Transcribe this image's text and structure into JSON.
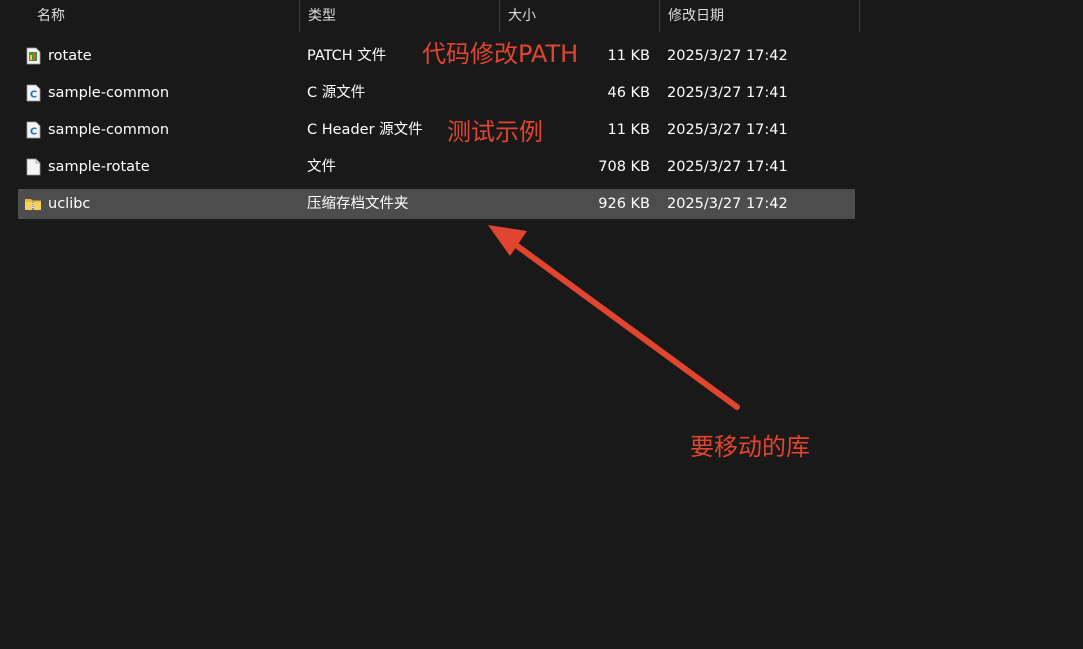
{
  "columns": {
    "name": "名称",
    "type": "类型",
    "size": "大小",
    "date": "修改日期"
  },
  "files": [
    {
      "name": "rotate",
      "type": "PATCH 文件",
      "size": "11 KB",
      "date": "2025/3/27 17:42",
      "icon": "patch-file-icon",
      "selected": false
    },
    {
      "name": "sample-common",
      "type": "C 源文件",
      "size": "46 KB",
      "date": "2025/3/27 17:41",
      "icon": "c-source-file-icon",
      "selected": false
    },
    {
      "name": "sample-common",
      "type": "C Header 源文件",
      "size": "11 KB",
      "date": "2025/3/27 17:41",
      "icon": "c-header-file-icon",
      "selected": false
    },
    {
      "name": "sample-rotate",
      "type": "文件",
      "size": "708 KB",
      "date": "2025/3/27 17:41",
      "icon": "blank-file-icon",
      "selected": false
    },
    {
      "name": "uclibc",
      "type": "压缩存档文件夹",
      "size": "926 KB",
      "date": "2025/3/27 17:42",
      "icon": "zip-folder-icon",
      "selected": true
    }
  ],
  "annotations": {
    "patch_note": "代码修改PATH",
    "test_note": "测试示例",
    "library_note": "要移动的库",
    "color": "#e2452f"
  }
}
